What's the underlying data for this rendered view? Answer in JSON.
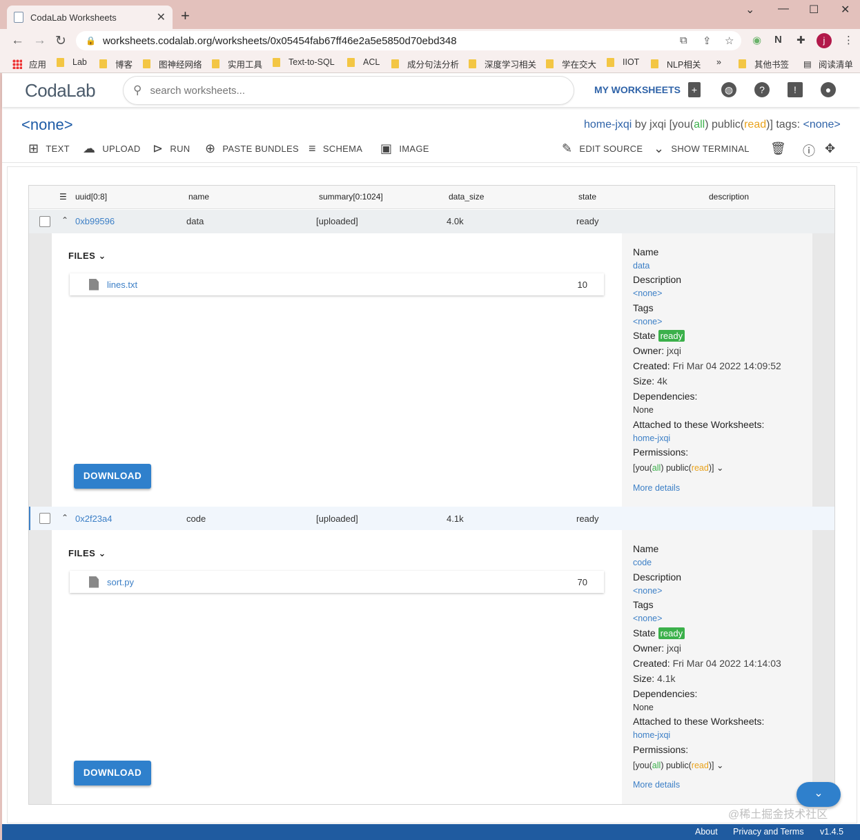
{
  "browser": {
    "tab_title": "CodaLab Worksheets",
    "url": "worksheets.codalab.org/worksheets/0x05454fab67ff46e2a5e5850d70ebd348",
    "bookmarks": [
      "应用",
      "Lab",
      "博客",
      "图神经网络",
      "实用工具",
      "Text-to-SQL",
      "ACL",
      "成分句法分析",
      "深度学习相关",
      "学在交大",
      "IIOT",
      "NLP相关"
    ],
    "more_bookmarks": "»",
    "other_bookmarks": "其他书签",
    "reading_list": "阅读清单",
    "profile_initial": "j"
  },
  "header": {
    "logo": "CodaLab",
    "search_placeholder": "search worksheets...",
    "my_worksheets": "MY WORKSHEETS"
  },
  "worksheet": {
    "title": "<none>",
    "name": "home-jxqi",
    "by": " by jxqi [you(",
    "all": "all",
    "public": ") public(",
    "read": "read",
    "close": ")]",
    "tags_label": "  tags: ",
    "tags_value": "<none>"
  },
  "actions": {
    "text": "TEXT",
    "upload": "UPLOAD",
    "run": "RUN",
    "paste": "PASTE BUNDLES",
    "schema": "SCHEMA",
    "image": "IMAGE",
    "edit": "EDIT SOURCE",
    "terminal": "SHOW TERMINAL"
  },
  "table": {
    "columns": [
      "uuid[0:8]",
      "name",
      "summary[0:1024]",
      "data_size",
      "state",
      "description"
    ],
    "rows": [
      {
        "uuid": "0xb99596",
        "name": "data",
        "summary": "[uploaded]",
        "size": "4.0k",
        "state": "ready",
        "files_label": "FILES",
        "file_name": "lines.txt",
        "file_size": "10",
        "download": "DOWNLOAD",
        "meta": {
          "name_label": "Name",
          "name": "data",
          "desc_label": "Description",
          "desc": "<none>",
          "tags_label": "Tags",
          "tags": "<none>",
          "state_label": "State",
          "state": "ready",
          "owner_label": "Owner:",
          "owner": "jxqi",
          "created_label": "Created:",
          "created": "Fri Mar 04 2022 14:09:52",
          "size_label": "Size:",
          "size": "4k",
          "deps_label": "Dependencies:",
          "deps": "None",
          "attached_label": "Attached to these Worksheets:",
          "attached": "home-jxqi",
          "perm_label": "Permissions:",
          "more": "More details"
        }
      },
      {
        "uuid": "0x2f23a4",
        "name": "code",
        "summary": "[uploaded]",
        "size": "4.1k",
        "state": "ready",
        "files_label": "FILES",
        "file_name": "sort.py",
        "file_size": "70",
        "download": "DOWNLOAD",
        "meta": {
          "name_label": "Name",
          "name": "code",
          "desc_label": "Description",
          "desc": "<none>",
          "tags_label": "Tags",
          "tags": "<none>",
          "state_label": "State",
          "state": "ready",
          "owner_label": "Owner:",
          "owner": "jxqi",
          "created_label": "Created:",
          "created": "Fri Mar 04 2022 14:14:03",
          "size_label": "Size:",
          "size": "4.1k",
          "deps_label": "Dependencies:",
          "deps": "None",
          "attached_label": "Attached to these Worksheets:",
          "attached": "home-jxqi",
          "perm_label": "Permissions:",
          "more": "More details"
        }
      }
    ],
    "perm": {
      "p1": "[you(",
      "all": "all",
      "p2": ") public(",
      "read": "read",
      "p3": ")]"
    }
  },
  "watermark": "@稀土掘金技术社区",
  "footer": {
    "about": "About",
    "privacy": "Privacy and Terms",
    "version": "v1.4.5"
  }
}
